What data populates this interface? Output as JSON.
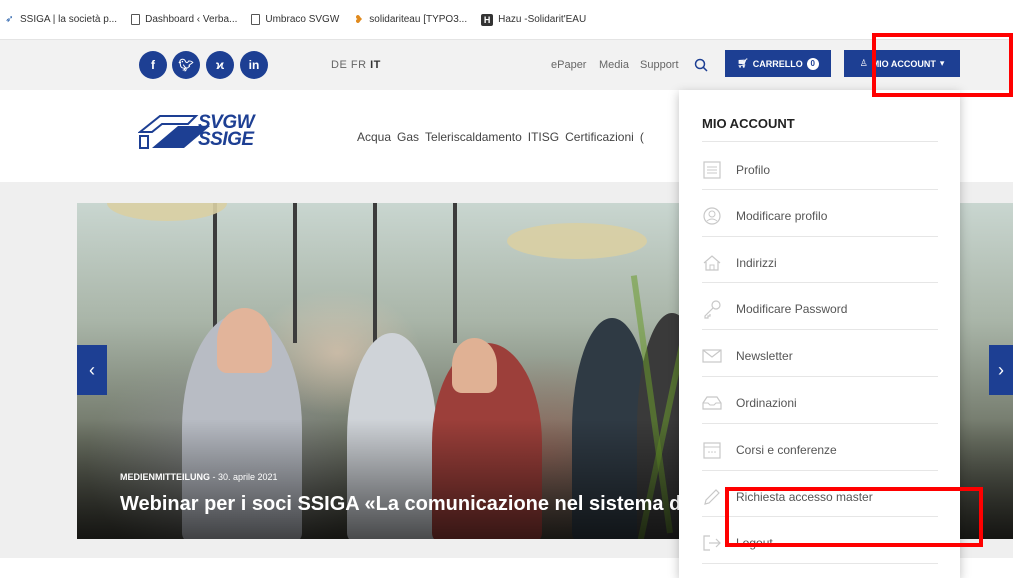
{
  "bookmarks": [
    {
      "label": "SSIGA | la società p...",
      "icon": "bird-icon"
    },
    {
      "label": "Dashboard ‹ Verba...",
      "icon": "page-icon"
    },
    {
      "label": "Umbraco SVGW",
      "icon": "page-icon"
    },
    {
      "label": "solidariteau [TYPO3...",
      "icon": "heart-icon"
    },
    {
      "label": "Hazu -Solidarit'EAU",
      "icon": "h-icon"
    }
  ],
  "social": [
    "f",
    "t",
    "x",
    "in"
  ],
  "languages": {
    "de": "DE",
    "fr": "FR",
    "it": "IT"
  },
  "utility": {
    "epaper": "ePaper",
    "media": "Media",
    "support": "Support"
  },
  "cart": {
    "label": "CARRELLO",
    "count": "0"
  },
  "account": {
    "label": "MIO ACCOUNT"
  },
  "logo": {
    "line1": "SVGW",
    "line2": "SSIGE"
  },
  "nav": [
    "Acqua",
    "Gas",
    "Teleriscaldamento",
    "ITISG",
    "Certificazioni",
    "("
  ],
  "hero": {
    "category": "MEDIENMITTEILUNG",
    "date": "30. aprile 2021",
    "title": "Webinar per i soci SSIGA «La comunicazione nel sistema di"
  },
  "dropdown": {
    "title": "MIO ACCOUNT",
    "items": [
      {
        "label": "Profilo",
        "icon": "profile-list-icon"
      },
      {
        "label": "Modificare profilo",
        "icon": "user-circle-icon"
      },
      {
        "label": "Indirizzi",
        "icon": "home-icon"
      },
      {
        "label": "Modificare Password",
        "icon": "key-icon"
      },
      {
        "label": "Newsletter",
        "icon": "envelope-icon"
      },
      {
        "label": "Ordinazioni",
        "icon": "inbox-icon"
      },
      {
        "label": "Corsi e conferenze",
        "icon": "calendar-icon"
      },
      {
        "label": "Richiesta accesso master",
        "icon": "pencil-icon"
      },
      {
        "label": "Logout",
        "icon": "logout-icon"
      }
    ]
  },
  "colors": {
    "brand": "#1d3f93",
    "annotation": "#ff0000"
  }
}
